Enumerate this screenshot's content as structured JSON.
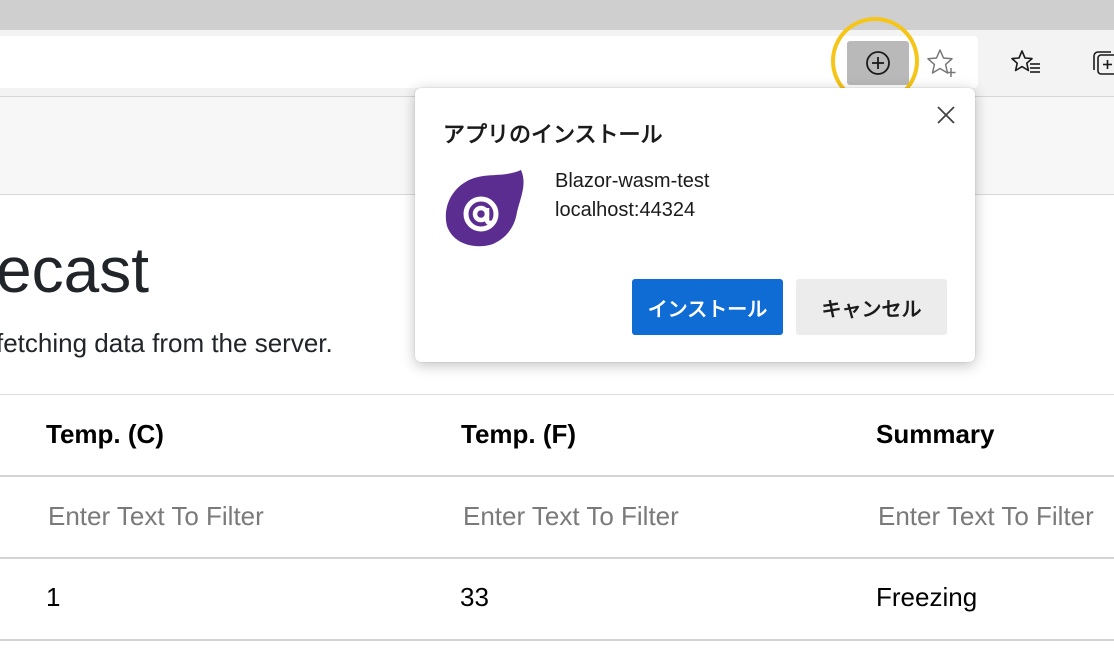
{
  "browser": {
    "install_icon": "plus-circle-icon",
    "favorite_icon": "add-favorite-star-icon",
    "favorites_icon": "favorites-list-icon",
    "collections_icon": "collections-icon",
    "highlight_color": "#f5c518"
  },
  "page": {
    "title": "ecast",
    "description": "fetching data from the server."
  },
  "table": {
    "headers": [
      "Temp. (C)",
      "Temp. (F)",
      "Summary"
    ],
    "filter_placeholder": "Enter Text To Filter",
    "rows": [
      [
        "1",
        "33",
        "Freezing"
      ]
    ]
  },
  "install_popup": {
    "title": "アプリのインストール",
    "app_name": "Blazor-wasm-test",
    "app_url": "localhost:44324",
    "app_icon": "blazor-logo-icon",
    "install_label": "インストール",
    "cancel_label": "キャンセル",
    "primary_color": "#0f6cd4",
    "icon_color": "#5c2d91"
  }
}
